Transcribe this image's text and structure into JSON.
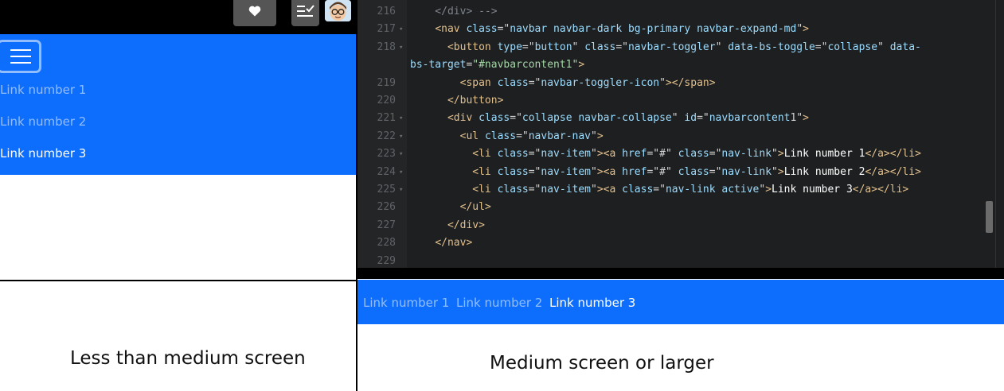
{
  "small_screen": {
    "links": [
      {
        "label": "Link number 1",
        "active": false
      },
      {
        "label": "Link number 2",
        "active": false
      },
      {
        "label": "Link number 3",
        "active": true
      }
    ],
    "caption": "Less than medium screen"
  },
  "large_screen": {
    "links": [
      {
        "label": "Link number 1",
        "active": false
      },
      {
        "label": "Link number 2",
        "active": false
      },
      {
        "label": "Link number 3",
        "active": true
      }
    ],
    "caption": "Medium screen or larger"
  },
  "toolbar": {
    "icons": [
      "heart-icon",
      "list-check-icon",
      "avatar-icon"
    ]
  },
  "editor": {
    "lines": [
      {
        "n": "216",
        "fold": "",
        "code": "    </div> -->"
      },
      {
        "n": "217",
        "fold": "▾",
        "code": "    <nav class=\"navbar navbar-dark bg-primary navbar-expand-md\">"
      },
      {
        "n": "218",
        "fold": "▾",
        "code": "      <button type=\"button\" class=\"navbar-toggler\" data-bs-toggle=\"collapse\" data-"
      },
      {
        "n": "",
        "fold": "",
        "code": "bs-target=\"#navbarcontent1\">"
      },
      {
        "n": "219",
        "fold": "",
        "code": "        <span class=\"navbar-toggler-icon\"></span>"
      },
      {
        "n": "220",
        "fold": "",
        "code": "      </button>"
      },
      {
        "n": "221",
        "fold": "▾",
        "code": "      <div class=\"collapse navbar-collapse\" id=\"navbarcontent1\">"
      },
      {
        "n": "222",
        "fold": "▾",
        "code": "        <ul class=\"navbar-nav\">"
      },
      {
        "n": "223",
        "fold": "▾",
        "code": "          <li class=\"nav-item\"><a href=\"#\" class=\"nav-link\">Link number 1</a></li>"
      },
      {
        "n": "224",
        "fold": "▾",
        "code": "          <li class=\"nav-item\"><a href=\"#\" class=\"nav-link\">Link number 2</a></li>"
      },
      {
        "n": "225",
        "fold": "▾",
        "code": "          <li class=\"nav-item\"><a class=\"nav-link active\">Link number 3</a></li>"
      },
      {
        "n": "226",
        "fold": "",
        "code": "        </ul>"
      },
      {
        "n": "227",
        "fold": "",
        "code": "      </div>"
      },
      {
        "n": "228",
        "fold": "",
        "code": "    </nav>"
      },
      {
        "n": "229",
        "fold": "",
        "code": ""
      }
    ]
  },
  "colors": {
    "primary": "#0d6efd",
    "editor_bg": "#1e1f20",
    "tag": "#e2c08d",
    "attribute": "#9cdcfe",
    "string": "#a5d6a7"
  }
}
